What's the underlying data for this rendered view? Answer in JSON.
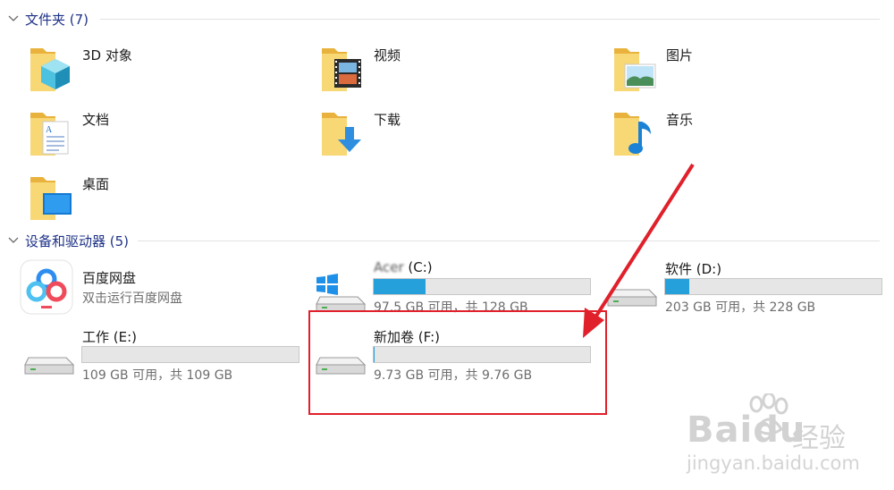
{
  "sections": {
    "folders": {
      "title": "文件夹 (7)"
    },
    "devices": {
      "title": "设备和驱动器 (5)"
    }
  },
  "folders": [
    {
      "label": "3D 对象",
      "icon": "3d-objects-folder-icon"
    },
    {
      "label": "视频",
      "icon": "videos-folder-icon"
    },
    {
      "label": "图片",
      "icon": "pictures-folder-icon"
    },
    {
      "label": "文档",
      "icon": "documents-folder-icon"
    },
    {
      "label": "下载",
      "icon": "downloads-folder-icon"
    },
    {
      "label": "音乐",
      "icon": "music-folder-icon"
    },
    {
      "label": "桌面",
      "icon": "desktop-folder-icon"
    }
  ],
  "devices": {
    "baidu": {
      "name": "百度网盘",
      "subtitle": "双击运行百度网盘"
    },
    "drives": [
      {
        "name_prefix": "Acer",
        "name": "(C:)",
        "info": "97.5 GB 可用，共 128 GB",
        "used_fraction": 0.238
      },
      {
        "name": "软件 (D:)",
        "info": "203 GB 可用，共 228 GB",
        "used_fraction": 0.11
      },
      {
        "name": "工作 (E:)",
        "info": "109 GB 可用，共 109 GB",
        "used_fraction": 0.0
      },
      {
        "name": "新加卷 (F:)",
        "info": "9.73 GB 可用，共 9.76 GB",
        "used_fraction": 0.003
      }
    ]
  },
  "watermark": {
    "brand": "Baidu",
    "cn": "经验",
    "url": "jingyan.baidu.com"
  },
  "colors": {
    "section_title": "#1e3287",
    "bar_fill": "#26a0da",
    "bar_bg": "#e6e6e6",
    "highlight": "#e0202a",
    "folder_yellow": "#f5c451"
  }
}
